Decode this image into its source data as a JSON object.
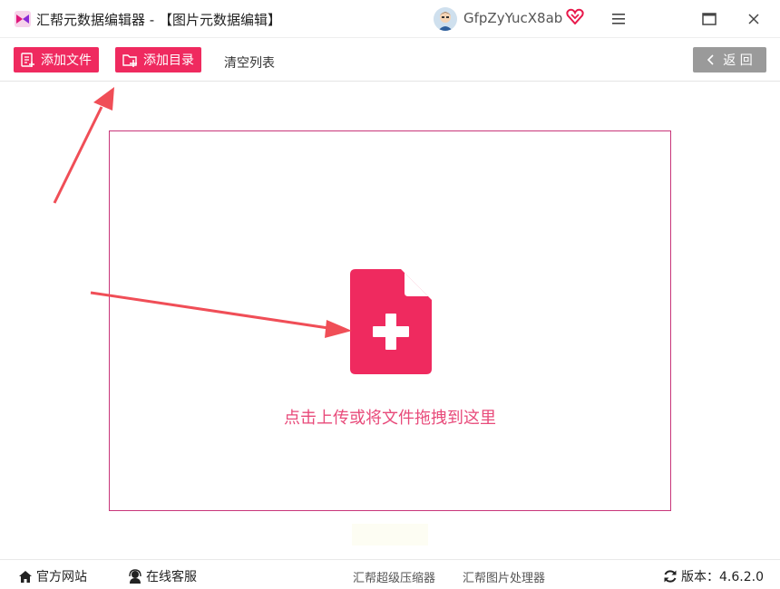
{
  "window": {
    "title": "汇帮元数据编辑器 - 【图片元数据编辑】",
    "username": "GfpZyYucX8ab"
  },
  "toolbar": {
    "add_file_label": "添加文件",
    "add_folder_label": "添加目录",
    "clear_list_label": "清空列表",
    "back_label": "返 回"
  },
  "dropzone": {
    "hint": "点击上传或将文件拖拽到这里"
  },
  "footer": {
    "website_label": "官方网站",
    "support_label": "在线客服",
    "link1_label": "汇帮超级压缩器",
    "link2_label": "汇帮图片处理器",
    "version_label": "版本：4.6.2.0"
  },
  "icons": [
    "app-logo-icon",
    "avatar",
    "vip-heart-icon",
    "menu-icon",
    "maximize-icon",
    "close-icon",
    "add-file-icon",
    "add-folder-icon",
    "chevron-left-icon",
    "file-add-icon",
    "home-icon",
    "headset-icon",
    "refresh-icon"
  ],
  "colors": {
    "accent": "#ef2a5f",
    "dropzone_border": "#c8357a",
    "hint_text": "#e84a7a",
    "back_button": "#9a9a9a",
    "annotation_arrow": "#f04e57"
  }
}
